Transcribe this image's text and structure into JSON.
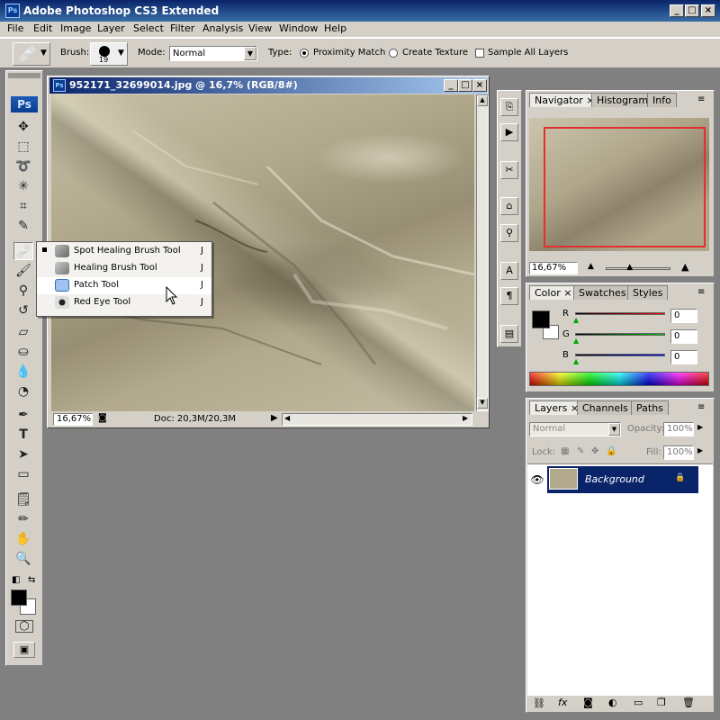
{
  "app": {
    "title": "Adobe Photoshop CS3 Extended",
    "icon_text": "Ps"
  },
  "menu": [
    "File",
    "Edit",
    "Image",
    "Layer",
    "Select",
    "Filter",
    "Analysis",
    "View",
    "Window",
    "Help"
  ],
  "options_bar": {
    "brush_label": "Brush:",
    "brush_size": "19",
    "mode_label": "Mode:",
    "mode_value": "Normal",
    "type_label": "Type:",
    "type_options": [
      "Proximity Match",
      "Create Texture"
    ],
    "type_selected": "Proximity Match",
    "sample_all_layers_label": "Sample All Layers",
    "sample_all_layers_checked": false
  },
  "toolbox": {
    "logo": "Ps",
    "tools": [
      "move-icon",
      "marquee-icon",
      "lasso-icon",
      "magic-wand-icon",
      "crop-icon",
      "slice-icon",
      "healing-brush-icon",
      "brush-icon",
      "clone-stamp-icon",
      "history-brush-icon",
      "eraser-icon",
      "paint-bucket-icon",
      "blur-icon",
      "dodge-icon",
      "pen-icon",
      "type-icon",
      "path-selection-icon",
      "rectangle-icon",
      "notes-icon",
      "eyedropper-icon",
      "hand-icon",
      "zoom-icon"
    ],
    "foreground_color": "#000000",
    "background_color": "#ffffff"
  },
  "flyout": {
    "items": [
      {
        "label": "Spot Healing Brush Tool",
        "key": "J",
        "selected": true
      },
      {
        "label": "Healing Brush Tool",
        "key": "J",
        "selected": false
      },
      {
        "label": "Patch Tool",
        "key": "J",
        "selected": false,
        "hover": true
      },
      {
        "label": "Red Eye Tool",
        "key": "J",
        "selected": false
      }
    ]
  },
  "document": {
    "title": "952171_32699014.jpg @ 16,7% (RGB/8#)",
    "icon_text": "Ps",
    "zoom": "16,67%",
    "doc_info": "Doc: 20,3M/20,3M"
  },
  "navigator": {
    "tabs": [
      "Navigator",
      "Histogram",
      "Info"
    ],
    "active_tab": "Navigator",
    "zoom": "16,67%",
    "zoom_slider_fraction": 0.35
  },
  "color_panel": {
    "tabs": [
      "Color",
      "Swatches",
      "Styles"
    ],
    "active_tab": "Color",
    "channels": [
      {
        "label": "R",
        "value": "0",
        "color": "#cc0000"
      },
      {
        "label": "G",
        "value": "0",
        "color": "#00a000"
      },
      {
        "label": "B",
        "value": "0",
        "color": "#0000cc"
      }
    ]
  },
  "layers_panel": {
    "tabs": [
      "Layers",
      "Channels",
      "Paths"
    ],
    "active_tab": "Layers",
    "blend_mode": "Normal",
    "opacity_label": "Opacity:",
    "opacity": "100%",
    "lock_label": "Lock:",
    "fill_label": "Fill:",
    "fill": "100%",
    "layers": [
      {
        "name": "Background",
        "visible": true,
        "locked": true
      }
    ],
    "footer_icons": [
      "link-icon",
      "fx-icon",
      "mask-icon",
      "adjustment-icon",
      "group-icon",
      "new-layer-icon",
      "trash-icon"
    ]
  },
  "colors": {
    "highlight": "#0a246a",
    "navigator_box": "#e03030"
  }
}
